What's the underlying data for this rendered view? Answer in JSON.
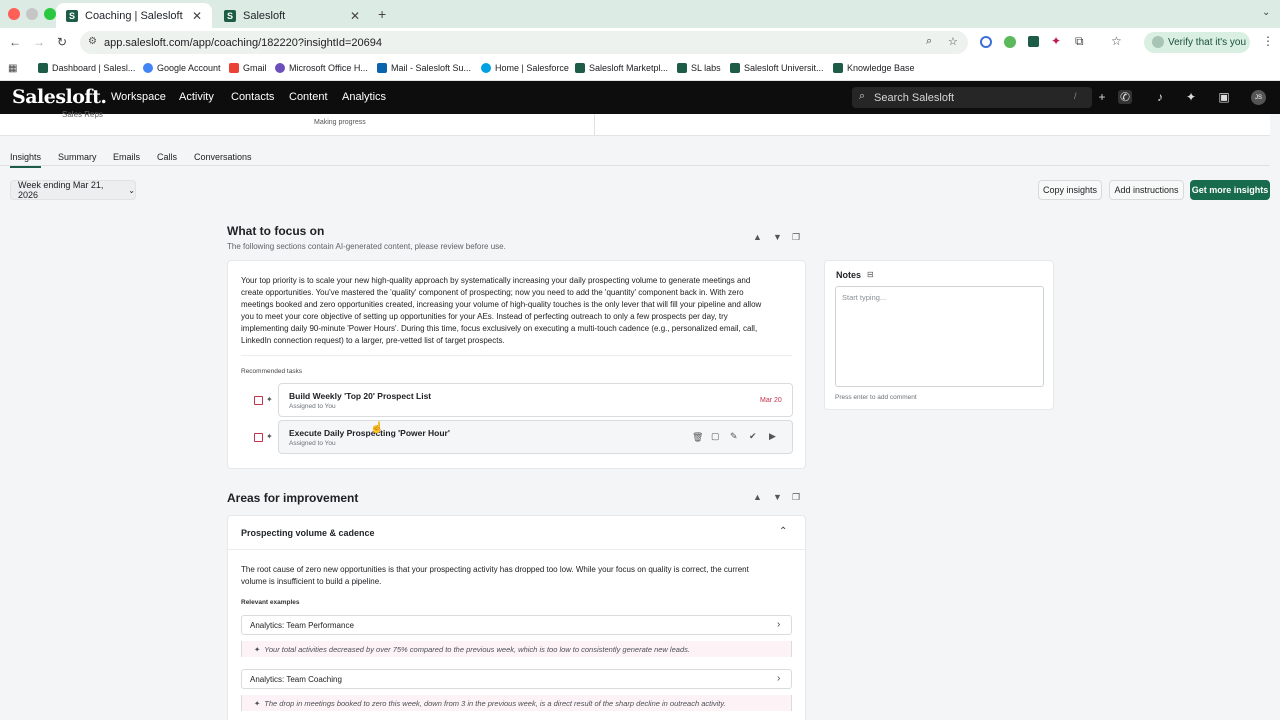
{
  "browser": {
    "tabs": [
      {
        "title": "Coaching | Salesloft",
        "active": true
      },
      {
        "title": "Salesloft",
        "active": false
      }
    ],
    "url": "app.salesloft.com/app/coaching/182220?insightId=20694",
    "verify_label": "Verify that it's you",
    "bookmarks": [
      "Dashboard | Salesl...",
      "Google Account",
      "Gmail",
      "Microsoft Office H...",
      "Mail - Salesloft Su...",
      "Home | Salesforce",
      "Salesloft Marketpl...",
      "SL labs",
      "Salesloft Universit...",
      "Knowledge Base"
    ]
  },
  "app": {
    "logo": "Salesloft.",
    "nav": [
      "Workspace",
      "Activity",
      "Contacts",
      "Content",
      "Analytics"
    ],
    "search_placeholder": "Search Salesloft",
    "search_shortcut": "/",
    "avatar_initials": "JS"
  },
  "top_strip": {
    "left_text": "Sales Reps",
    "status_text": "Making progress"
  },
  "subtabs": [
    "Insights",
    "Summary",
    "Emails",
    "Calls",
    "Conversations"
  ],
  "week_selector": "Week ending Mar 21, 2026",
  "actions": {
    "copy": "Copy insights",
    "instructions": "Add instructions",
    "more": "Get more insights"
  },
  "focus": {
    "title": "What to focus on",
    "subtitle": "The following sections contain AI-generated content, please review before use.",
    "paragraph_lines": [
      "Your top priority is to scale your new high-quality approach by systematically increasing your daily prospecting volume to generate meetings and",
      "create opportunities. You've mastered the 'quality' component of prospecting; now you need to add the 'quantity' component back in. With zero",
      "meetings booked and zero opportunities created, increasing your volume of high-quality touches is the only lever that will fill your pipeline and allow",
      "you to meet your core objective of setting up opportunities for your AEs. Instead of perfecting outreach to only a few prospects per day, try",
      "implementing daily 90-minute 'Power Hours'. During this time, focus exclusively on executing a multi-touch cadence (e.g., personalized email, call,",
      "LinkedIn connection request) to a larger, pre-vetted list of target prospects."
    ],
    "tasks_label": "Recommended tasks",
    "tasks": [
      {
        "title": "Build Weekly 'Top 20' Prospect List",
        "assignee": "Assigned to You",
        "due": "Mar 20"
      },
      {
        "title": "Execute Daily Prospecting 'Power Hour'",
        "assignee": "Assigned to You",
        "due": ""
      }
    ]
  },
  "notes": {
    "title": "Notes",
    "placeholder": "Start typing...",
    "hint": "Press enter to add comment"
  },
  "improvement": {
    "title": "Areas for improvement",
    "section_title": "Prospecting volume & cadence",
    "paragraph_lines": [
      "The root cause of zero new opportunities is that your prospecting activity has dropped too low. While your focus on quality is correct, the current",
      "volume is insufficient to build a pipeline."
    ],
    "examples_label": "Relevant examples",
    "examples": [
      {
        "title": "Analytics: Team Performance",
        "insight": "Your total activities decreased by over 75% compared to the previous week, which is too low to consistently generate new leads."
      },
      {
        "title": "Analytics: Team Coaching",
        "insight": "The drop in meetings booked to zero this week, down from 3 in the previous week, is a direct result of the sharp decline in outreach activity."
      }
    ]
  },
  "colors": {
    "brand_green": "#186b4c",
    "header_black": "#0d0d0d",
    "due_red": "#c4314b"
  }
}
